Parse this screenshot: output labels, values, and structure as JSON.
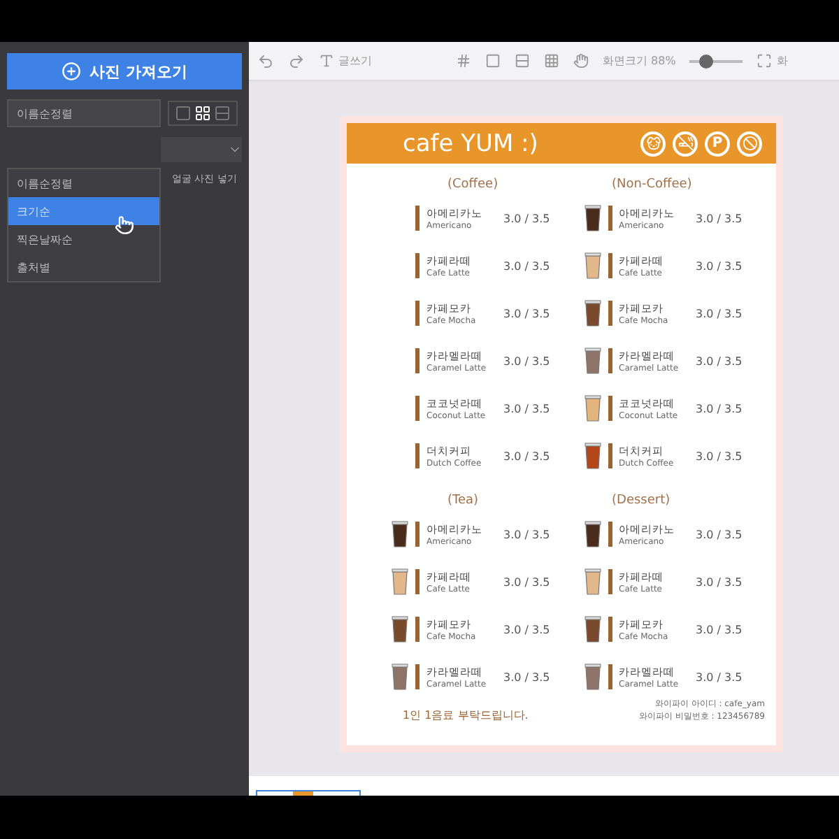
{
  "sidebar": {
    "import_button": "사진 가져오기",
    "sort_select": "이름순정렬",
    "sort_options": [
      {
        "label": "이름순정렬",
        "selected": false
      },
      {
        "label": "크기순",
        "selected": true
      },
      {
        "label": "찍은날짜순",
        "selected": false
      },
      {
        "label": "출처별",
        "selected": false
      }
    ],
    "view_modes": [
      {
        "kind": "single",
        "selected": false
      },
      {
        "kind": "grid",
        "selected": true
      },
      {
        "kind": "list",
        "selected": false
      }
    ],
    "face_label": "얼굴 사진 넣기"
  },
  "toolbar": {
    "write_label": "글쓰기",
    "zoom_label": "화면크기 88%",
    "zoom": {
      "level": 0.3
    },
    "fit_label": "화"
  },
  "menu": {
    "title": "cafe YUM :)",
    "parking": "P",
    "sections": [
      {
        "title": "(Coffee)",
        "items": [
          {
            "ko": "아메리카노",
            "en": "Americano",
            "price": "3.0 / 3.5"
          },
          {
            "ko": "카페라떼",
            "en": "Cafe Latte",
            "price": "3.0 / 3.5"
          },
          {
            "ko": "카페모카",
            "en": "Cafe Mocha",
            "price": "3.0 / 3.5"
          },
          {
            "ko": "카라멜라떼",
            "en": "Caramel Latte",
            "price": "3.0 / 3.5"
          },
          {
            "ko": "코코넛라떼",
            "en": "Coconut Latte",
            "price": "3.0 / 3.5"
          },
          {
            "ko": "더치커피",
            "en": "Dutch Coffee",
            "price": "3.0 / 3.5"
          }
        ]
      },
      {
        "title": "(Non-Coffee)",
        "items": [
          {
            "ko": "아메리카노",
            "en": "Americano",
            "price": "3.0 / 3.5",
            "color": "#4a2c1c"
          },
          {
            "ko": "카페라떼",
            "en": "Cafe Latte",
            "price": "3.0 / 3.5",
            "color": "#e2b78a"
          },
          {
            "ko": "카페모카",
            "en": "Cafe Mocha",
            "price": "3.0 / 3.5",
            "color": "#7a4a2c"
          },
          {
            "ko": "카라멜라떼",
            "en": "Caramel Latte",
            "price": "3.0 / 3.5",
            "color": "#8e7468"
          },
          {
            "ko": "코코넛라떼",
            "en": "Coconut Latte",
            "price": "3.0 / 3.5",
            "color": "#e3b47e"
          },
          {
            "ko": "더치커피",
            "en": "Dutch Coffee",
            "price": "3.0 / 3.5",
            "color": "#b4471a"
          }
        ]
      },
      {
        "title": "(Tea)",
        "items": [
          {
            "ko": "아메리카노",
            "en": "Americano",
            "price": "3.0 / 3.5",
            "color": "#4a2c1c"
          },
          {
            "ko": "카페라떼",
            "en": "Cafe Latte",
            "price": "3.0 / 3.5",
            "color": "#e2b78a"
          },
          {
            "ko": "카페모카",
            "en": "Cafe Mocha",
            "price": "3.0 / 3.5",
            "color": "#7a4a2c"
          },
          {
            "ko": "카라멜라떼",
            "en": "Caramel Latte",
            "price": "3.0 / 3.5",
            "color": "#8e7468"
          }
        ]
      },
      {
        "title": "(Dessert)",
        "items": [
          {
            "ko": "아메리카노",
            "en": "Americano",
            "price": "3.0 / 3.5",
            "color": "#4a2c1c"
          },
          {
            "ko": "카페라떼",
            "en": "Cafe Latte",
            "price": "3.0 / 3.5",
            "color": "#e2b78a"
          },
          {
            "ko": "카페모카",
            "en": "Cafe Mocha",
            "price": "3.0 / 3.5",
            "color": "#7a4a2c"
          },
          {
            "ko": "카라멜라떼",
            "en": "Caramel Latte",
            "price": "3.0 / 3.5",
            "color": "#8e7468"
          }
        ]
      }
    ],
    "notice": "1인 1음료 부탁드립니다.",
    "wifi": [
      "와이파이 아이디 : cafe_yam",
      "와이파이 비밀번호 : 123456789"
    ]
  }
}
